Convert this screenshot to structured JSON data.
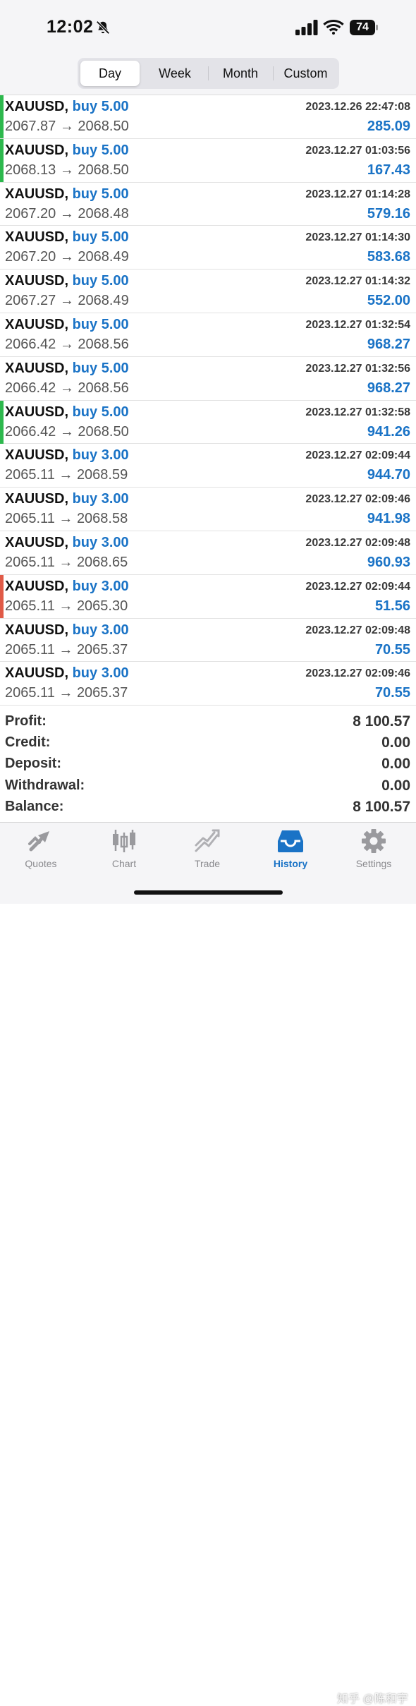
{
  "status_bar": {
    "time": "12:02",
    "battery": "74"
  },
  "periods": {
    "day": "Day",
    "week": "Week",
    "month": "Month",
    "custom": "Custom",
    "active": "Day"
  },
  "trades": [
    {
      "symbol": "XAUUSD,",
      "type": "buy 5.00",
      "datetime": "2023.12.26 22:47:08",
      "open": "2067.87",
      "close": "2068.50",
      "profit": "285.09",
      "marker": "#2db84d"
    },
    {
      "symbol": "XAUUSD,",
      "type": "buy 5.00",
      "datetime": "2023.12.27 01:03:56",
      "open": "2068.13",
      "close": "2068.50",
      "profit": "167.43",
      "marker": "#2db84d"
    },
    {
      "symbol": "XAUUSD,",
      "type": "buy 5.00",
      "datetime": "2023.12.27 01:14:28",
      "open": "2067.20",
      "close": "2068.48",
      "profit": "579.16",
      "marker": ""
    },
    {
      "symbol": "XAUUSD,",
      "type": "buy 5.00",
      "datetime": "2023.12.27 01:14:30",
      "open": "2067.20",
      "close": "2068.49",
      "profit": "583.68",
      "marker": ""
    },
    {
      "symbol": "XAUUSD,",
      "type": "buy 5.00",
      "datetime": "2023.12.27 01:14:32",
      "open": "2067.27",
      "close": "2068.49",
      "profit": "552.00",
      "marker": ""
    },
    {
      "symbol": "XAUUSD,",
      "type": "buy 5.00",
      "datetime": "2023.12.27 01:32:54",
      "open": "2066.42",
      "close": "2068.56",
      "profit": "968.27",
      "marker": ""
    },
    {
      "symbol": "XAUUSD,",
      "type": "buy 5.00",
      "datetime": "2023.12.27 01:32:56",
      "open": "2066.42",
      "close": "2068.56",
      "profit": "968.27",
      "marker": ""
    },
    {
      "symbol": "XAUUSD,",
      "type": "buy 5.00",
      "datetime": "2023.12.27 01:32:58",
      "open": "2066.42",
      "close": "2068.50",
      "profit": "941.26",
      "marker": "#2db84d"
    },
    {
      "symbol": "XAUUSD,",
      "type": "buy 3.00",
      "datetime": "2023.12.27 02:09:44",
      "open": "2065.11",
      "close": "2068.59",
      "profit": "944.70",
      "marker": ""
    },
    {
      "symbol": "XAUUSD,",
      "type": "buy 3.00",
      "datetime": "2023.12.27 02:09:46",
      "open": "2065.11",
      "close": "2068.58",
      "profit": "941.98",
      "marker": ""
    },
    {
      "symbol": "XAUUSD,",
      "type": "buy 3.00",
      "datetime": "2023.12.27 02:09:48",
      "open": "2065.11",
      "close": "2068.65",
      "profit": "960.93",
      "marker": ""
    },
    {
      "symbol": "XAUUSD,",
      "type": "buy 3.00",
      "datetime": "2023.12.27 02:09:44",
      "open": "2065.11",
      "close": "2065.30",
      "profit": "51.56",
      "marker": "#e05a47"
    },
    {
      "symbol": "XAUUSD,",
      "type": "buy 3.00",
      "datetime": "2023.12.27 02:09:48",
      "open": "2065.11",
      "close": "2065.37",
      "profit": "70.55",
      "marker": ""
    },
    {
      "symbol": "XAUUSD,",
      "type": "buy 3.00",
      "datetime": "2023.12.27 02:09:46",
      "open": "2065.11",
      "close": "2065.37",
      "profit": "70.55",
      "marker": ""
    }
  ],
  "arrow": "→",
  "summary": [
    {
      "label": "Profit:",
      "value": "8 100.57"
    },
    {
      "label": "Credit:",
      "value": "0.00"
    },
    {
      "label": "Deposit:",
      "value": "0.00"
    },
    {
      "label": "Withdrawal:",
      "value": "0.00"
    },
    {
      "label": "Balance:",
      "value": "8 100.57"
    }
  ],
  "tabs": {
    "quotes": "Quotes",
    "chart": "Chart",
    "trade": "Trade",
    "history": "History",
    "settings": "Settings",
    "active": "History"
  },
  "watermark": "知乎 @陈和宇",
  "colors": {
    "accent": "#1a73c6",
    "profit_marker": "#2db84d",
    "loss_marker": "#e05a47",
    "tab_inactive": "#8a8a8e"
  }
}
